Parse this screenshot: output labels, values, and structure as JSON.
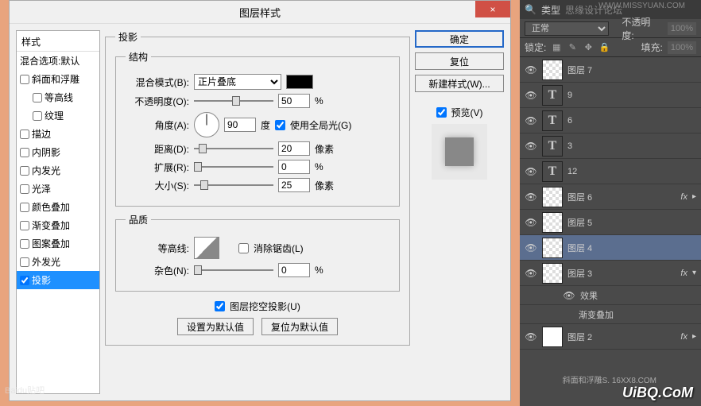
{
  "dialog": {
    "title": "图层样式",
    "close": "×",
    "styles_panel": {
      "header": "样式",
      "blending": "混合选项:默认",
      "items": [
        {
          "label": "斜面和浮雕",
          "checked": false,
          "sub": false
        },
        {
          "label": "等高线",
          "checked": false,
          "sub": true
        },
        {
          "label": "纹理",
          "checked": false,
          "sub": true
        },
        {
          "label": "描边",
          "checked": false,
          "sub": false
        },
        {
          "label": "内阴影",
          "checked": false,
          "sub": false
        },
        {
          "label": "内发光",
          "checked": false,
          "sub": false
        },
        {
          "label": "光泽",
          "checked": false,
          "sub": false
        },
        {
          "label": "颜色叠加",
          "checked": false,
          "sub": false
        },
        {
          "label": "渐变叠加",
          "checked": false,
          "sub": false
        },
        {
          "label": "图案叠加",
          "checked": false,
          "sub": false
        },
        {
          "label": "外发光",
          "checked": false,
          "sub": false
        },
        {
          "label": "投影",
          "checked": true,
          "sub": false,
          "selected": true
        }
      ]
    },
    "shadow": {
      "group_title": "投影",
      "structure_title": "结构",
      "blend_mode_label": "混合模式(B):",
      "blend_mode_value": "正片叠底",
      "opacity_label": "不透明度(O):",
      "opacity_value": "50",
      "opacity_unit": "%",
      "angle_label": "角度(A):",
      "angle_value": "90",
      "angle_unit": "度",
      "global_light": "使用全局光(G)",
      "distance_label": "距离(D):",
      "distance_value": "20",
      "distance_unit": "像素",
      "spread_label": "扩展(R):",
      "spread_value": "0",
      "spread_unit": "%",
      "size_label": "大小(S):",
      "size_value": "25",
      "size_unit": "像素",
      "quality_title": "品质",
      "contour_label": "等高线:",
      "antialias": "消除锯齿(L)",
      "noise_label": "杂色(N):",
      "noise_value": "0",
      "noise_unit": "%",
      "knockout": "图层挖空投影(U)",
      "make_default": "设置为默认值",
      "reset_default": "复位为默认值"
    },
    "buttons": {
      "ok": "确定",
      "cancel": "复位",
      "new_style": "新建样式(W)...",
      "preview": "预览(V)"
    }
  },
  "layers_panel": {
    "kind_label": "类型",
    "blend_mode": "正常",
    "opacity_label": "不透明度:",
    "opacity_value": "100%",
    "lock_label": "锁定:",
    "fill_label": "填充:",
    "fill_value": "100%",
    "layers": [
      {
        "name": "图层 7",
        "type": "pixel"
      },
      {
        "name": "9",
        "type": "text"
      },
      {
        "name": "6",
        "type": "text"
      },
      {
        "name": "3",
        "type": "text"
      },
      {
        "name": "12",
        "type": "text"
      },
      {
        "name": "图层 6",
        "type": "pixel",
        "fx": true
      },
      {
        "name": "图层 5",
        "type": "pixel"
      },
      {
        "name": "图层 4",
        "type": "pixel",
        "selected": true
      },
      {
        "name": "图层 3",
        "type": "pixel",
        "fx": true,
        "expanded": true
      },
      {
        "name": "图层 2",
        "type": "white",
        "fx": true
      }
    ],
    "effects_label": "效果",
    "gradient_overlay": "渐变叠加"
  },
  "watermarks": {
    "top": "WWW.MISSYUAN.COM",
    "top_left": "思缘设计论坛",
    "bottom": "UiBQ.CoM",
    "bl": "Baidu贴吧",
    "br2": "斜面和浮雕S. 16XX8.COM"
  }
}
